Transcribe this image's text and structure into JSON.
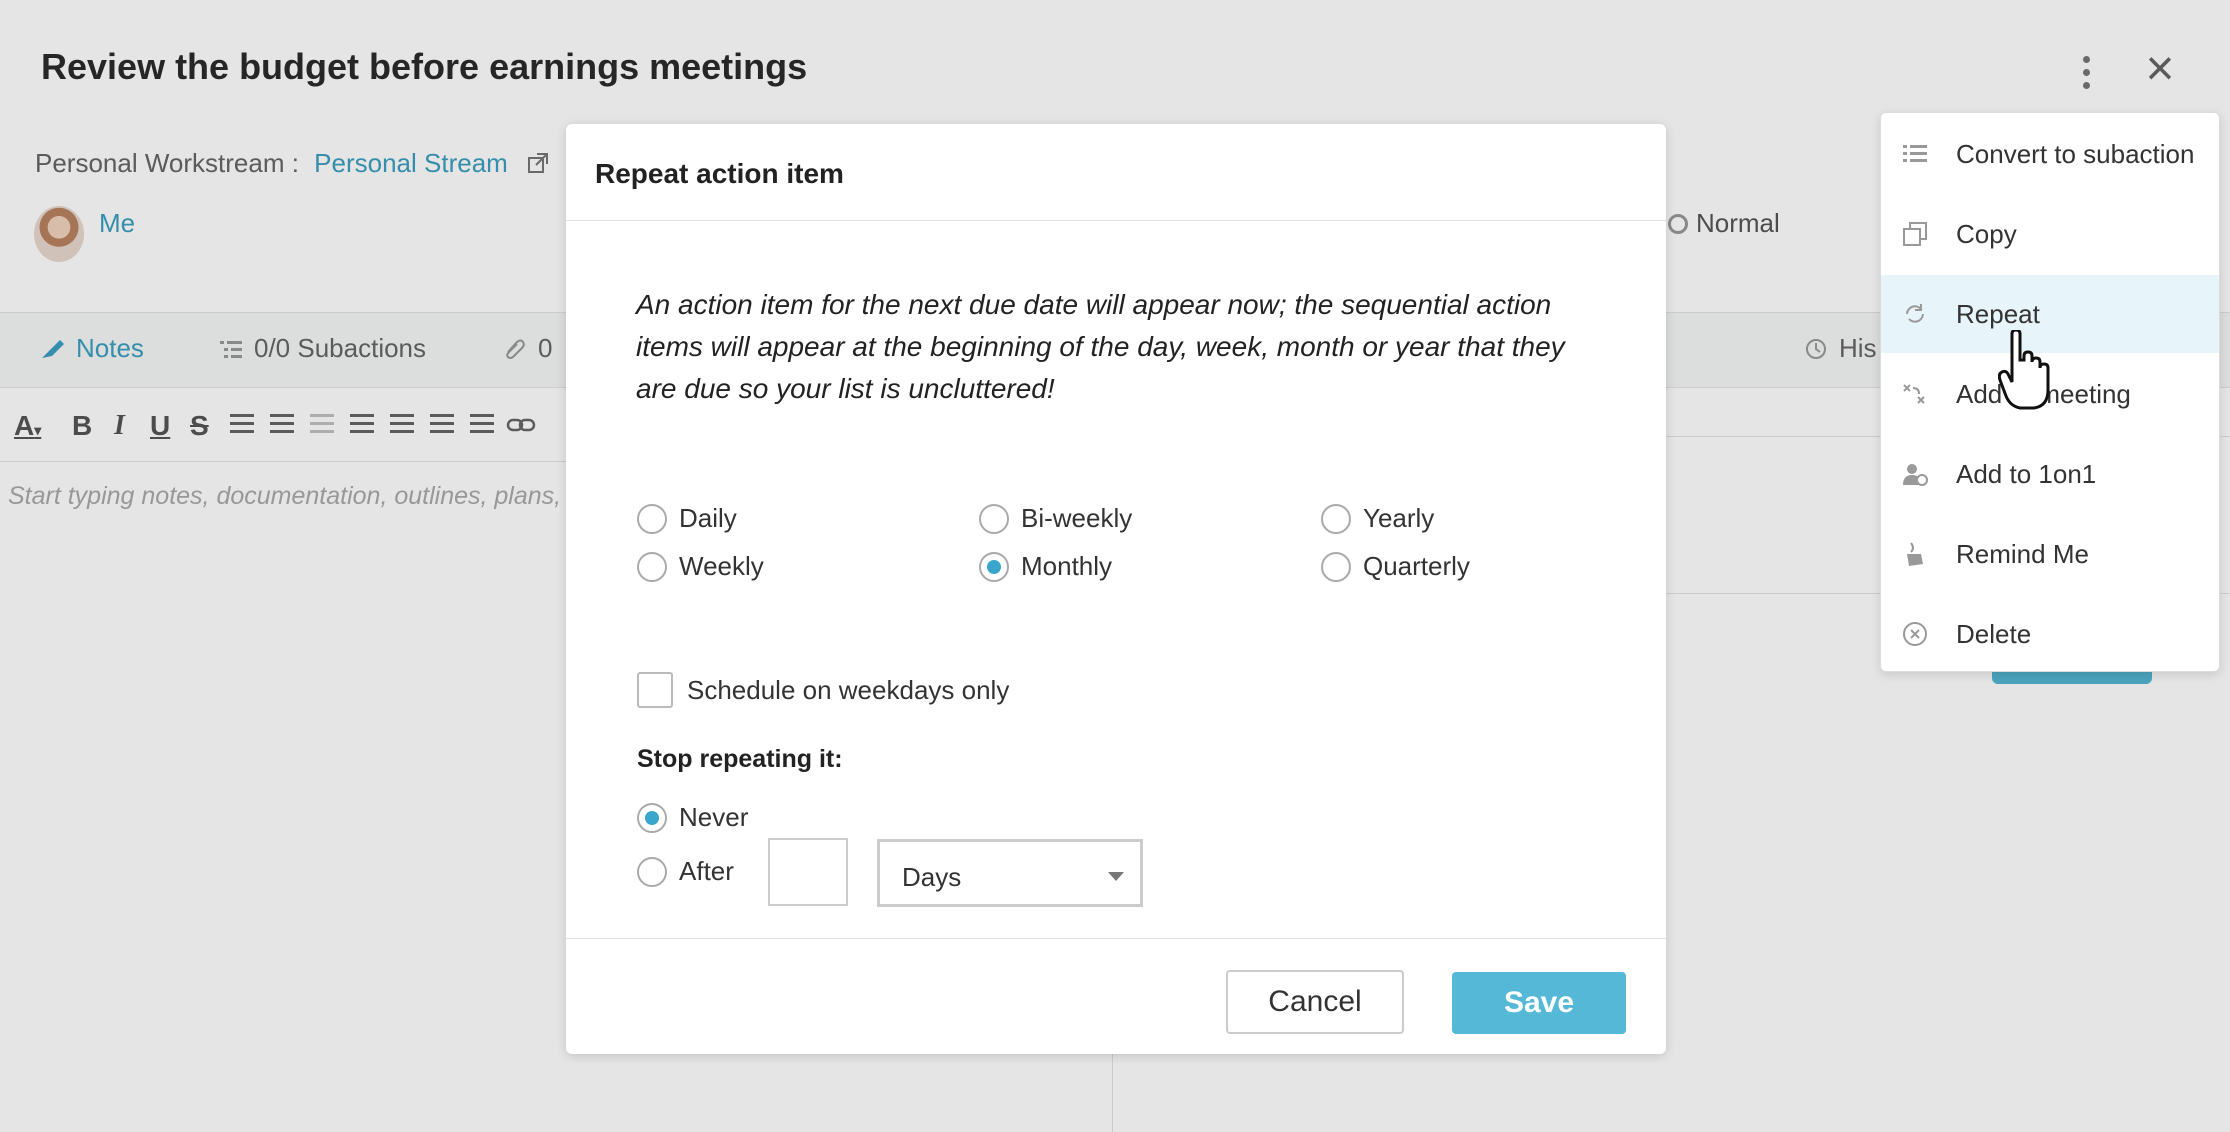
{
  "task": {
    "title": "Review the budget before earnings meetings",
    "workstream_label": "Personal Workstream :",
    "workstream_link": "Personal Stream",
    "assignee": "Me",
    "priority": "Normal"
  },
  "tabs": [
    {
      "label": "Notes"
    },
    {
      "label": "0/0 Subactions"
    },
    {
      "label": "0"
    },
    {
      "label": "His"
    }
  ],
  "editor": {
    "placeholder": "Start typing notes, documentation, outlines, plans, sta"
  },
  "modal": {
    "title": "Repeat action item",
    "description": "An action item for the next due date will appear now; the sequential action items will appear at the beginning of the day, week, month or year that they are due so your list is uncluttered!",
    "frequency": {
      "options": [
        "Daily",
        "Bi-weekly",
        "Yearly",
        "Weekly",
        "Monthly",
        "Quarterly"
      ],
      "selected": "Monthly"
    },
    "weekdays_only_label": "Schedule on weekdays only",
    "weekdays_only_checked": false,
    "stop_label": "Stop repeating it:",
    "stop_never_label": "Never",
    "stop_after_label": "After",
    "stop_selected": "Never",
    "after_count": "",
    "unit_value": "Days",
    "cancel_label": "Cancel",
    "save_label": "Save"
  },
  "menu": {
    "items": [
      {
        "label": "Convert to subaction",
        "icon": "list-icon"
      },
      {
        "label": "Copy",
        "icon": "copy-icon"
      },
      {
        "label": "Repeat",
        "icon": "repeat-icon"
      },
      {
        "label": "Add to meeting",
        "icon": "meeting-icon"
      },
      {
        "label": "Add to 1on1",
        "icon": "one-on-one-icon"
      },
      {
        "label": "Remind Me",
        "icon": "remind-icon"
      },
      {
        "label": "Delete",
        "icon": "delete-icon"
      }
    ],
    "highlighted": "Repeat"
  },
  "colors": {
    "accent": "#3a9fc0",
    "save_button": "#54b8d6",
    "highlight": "#e7f4f9"
  }
}
